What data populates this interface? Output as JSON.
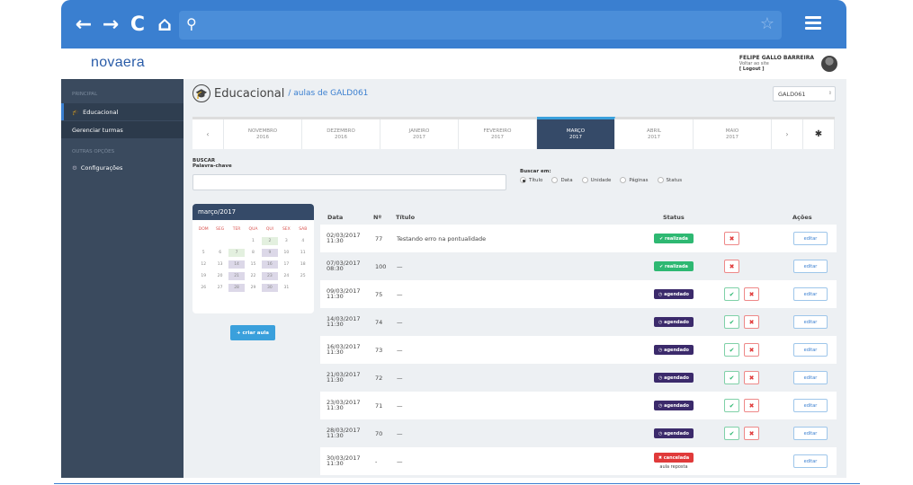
{
  "browser": {
    "back_icon": "←",
    "forward_icon": "→",
    "reload_icon": "C",
    "home_icon": "⌂",
    "search_icon": "⚲",
    "star_icon": "☆"
  },
  "app": {
    "logo": "novaera",
    "user_name": "FELIPE GALLO BARREIRA",
    "user_sub": "Voltar ao site",
    "logout": "[ Logout ]"
  },
  "sidebar": {
    "section1": "PRINCIPAL",
    "items1": [
      {
        "label": "Educacional"
      },
      {
        "label": "Gerenciar turmas"
      }
    ],
    "section2": "OUTRAS OPÇÕES",
    "items2": [
      {
        "label": "Configurações"
      }
    ]
  },
  "page": {
    "title": "Educacional",
    "crumb": "/ aulas de GALD061",
    "select_value": "GALD061"
  },
  "months": [
    {
      "name": "NOVEMBRO",
      "year": "2016"
    },
    {
      "name": "DEZEMBRO",
      "year": "2016"
    },
    {
      "name": "JANEIRO",
      "year": "2017"
    },
    {
      "name": "FEVEREIRO",
      "year": "2017"
    },
    {
      "name": "MARÇO",
      "year": "2017"
    },
    {
      "name": "ABRIL",
      "year": "2017"
    },
    {
      "name": "MAIO",
      "year": "2017"
    }
  ],
  "search": {
    "label": "BUSCAR",
    "sublabel": "Palavra-chave",
    "in_label": "Buscar em:",
    "options": [
      "Título",
      "Data",
      "Unidade",
      "Páginas",
      "Status"
    ]
  },
  "calendar": {
    "title": "março/2017",
    "days_header": [
      "DOM",
      "SEG",
      "TER",
      "QUA",
      "QUI",
      "SEX",
      "SAB"
    ],
    "create_button": "+ criar aula"
  },
  "table": {
    "headers": {
      "date": "Data",
      "num": "Nº",
      "title": "Título",
      "status": "Status",
      "actions": "Ações"
    },
    "edit_label": "editar",
    "rows": [
      {
        "date": "02/03/2017",
        "time": "11:30",
        "num": "77",
        "title": "Testando erro na pontualidade",
        "status": "✔ realizada",
        "type": "realizada"
      },
      {
        "date": "07/03/2017",
        "time": "08:30",
        "num": "100",
        "title": "—",
        "status": "✔ realizada",
        "type": "realizada"
      },
      {
        "date": "09/03/2017",
        "time": "11:30",
        "num": "75",
        "title": "—",
        "status": "◷ agendado",
        "type": "agendado"
      },
      {
        "date": "14/03/2017",
        "time": "11:30",
        "num": "74",
        "title": "—",
        "status": "◷ agendado",
        "type": "agendado"
      },
      {
        "date": "16/03/2017",
        "time": "11:30",
        "num": "73",
        "title": "—",
        "status": "◷ agendado",
        "type": "agendado"
      },
      {
        "date": "21/03/2017",
        "time": "11:30",
        "num": "72",
        "title": "—",
        "status": "◷ agendado",
        "type": "agendado"
      },
      {
        "date": "23/03/2017",
        "time": "11:30",
        "num": "71",
        "title": "—",
        "status": "◷ agendado",
        "type": "agendado"
      },
      {
        "date": "28/03/2017",
        "time": "11:30",
        "num": "70",
        "title": "—",
        "status": "◷ agendado",
        "type": "agendado"
      },
      {
        "date": "30/03/2017",
        "time": "11:30",
        "num": "-",
        "title": "—",
        "status": "✖ cancelada",
        "type": "cancelada",
        "note": "aula reposta"
      }
    ]
  }
}
